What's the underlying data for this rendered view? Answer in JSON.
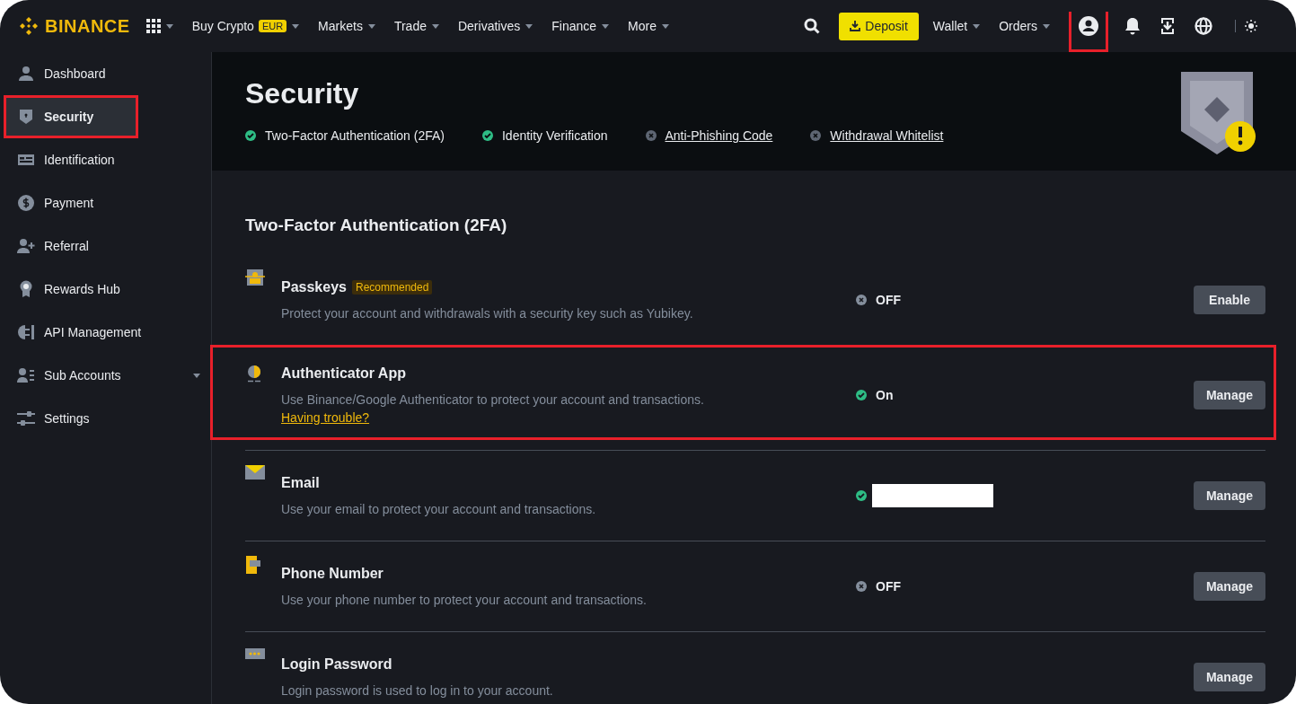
{
  "nav": {
    "logo": "BINANCE",
    "menus": [
      {
        "label": "Buy Crypto",
        "badge": "EUR"
      },
      {
        "label": "Markets"
      },
      {
        "label": "Trade"
      },
      {
        "label": "Derivatives"
      },
      {
        "label": "Finance"
      },
      {
        "label": "More"
      }
    ],
    "deposit": "Deposit",
    "right_menus": [
      "Wallet",
      "Orders"
    ],
    "profile_highlighted": true
  },
  "sidebar": {
    "items": [
      {
        "label": "Dashboard",
        "kind": "person",
        "selected": false,
        "highlighted": false,
        "expandable": false
      },
      {
        "label": "Security",
        "kind": "shield",
        "selected": true,
        "highlighted": true,
        "expandable": false
      },
      {
        "label": "Identification",
        "kind": "idcard",
        "selected": false,
        "highlighted": false,
        "expandable": false
      },
      {
        "label": "Payment",
        "kind": "dollar",
        "selected": false,
        "highlighted": false,
        "expandable": false
      },
      {
        "label": "Referral",
        "kind": "personplus",
        "selected": false,
        "highlighted": false,
        "expandable": false
      },
      {
        "label": "Rewards Hub",
        "kind": "medal",
        "selected": false,
        "highlighted": false,
        "expandable": false
      },
      {
        "label": "API Management",
        "kind": "api",
        "selected": false,
        "highlighted": false,
        "expandable": false
      },
      {
        "label": "Sub Accounts",
        "kind": "people",
        "selected": false,
        "highlighted": false,
        "expandable": true
      },
      {
        "label": "Settings",
        "kind": "sliders",
        "selected": false,
        "highlighted": false,
        "expandable": false
      }
    ]
  },
  "header": {
    "title": "Security",
    "checks": [
      {
        "label": "Two-Factor Authentication (2FA)",
        "done": true
      },
      {
        "label": "Identity Verification",
        "done": true
      },
      {
        "label": "Anti-Phishing Code",
        "done": false
      },
      {
        "label": "Withdrawal Whitelist",
        "done": false
      }
    ]
  },
  "section": {
    "title": "Two-Factor Authentication (2FA)",
    "methods": [
      {
        "name": "Passkeys",
        "badge": "Recommended",
        "kind": "passkey",
        "description": "Protect your account and withdrawals with a security key such as Yubikey.",
        "status": {
          "on": false,
          "text": "OFF"
        },
        "button": "Enable",
        "highlighted": false
      },
      {
        "name": "Authenticator App",
        "kind": "authenticator",
        "description": "Use Binance/Google Authenticator to protect your account and transactions.",
        "link": "Having trouble?",
        "status": {
          "on": true,
          "text": "On"
        },
        "button": "Manage",
        "highlighted": true
      },
      {
        "name": "Email",
        "kind": "envelope",
        "description": "Use your email to protect your account and transactions.",
        "status": {
          "on": true,
          "redacted": true
        },
        "button": "Manage",
        "highlighted": false
      },
      {
        "name": "Phone Number",
        "kind": "phone",
        "description": "Use your phone number to protect your account and transactions.",
        "status": {
          "on": false,
          "text": "OFF"
        },
        "button": "Manage",
        "highlighted": false
      },
      {
        "name": "Login Password",
        "kind": "password",
        "description": "Login password is used to log in to your account.",
        "button": "Manage",
        "highlighted": false
      }
    ]
  }
}
